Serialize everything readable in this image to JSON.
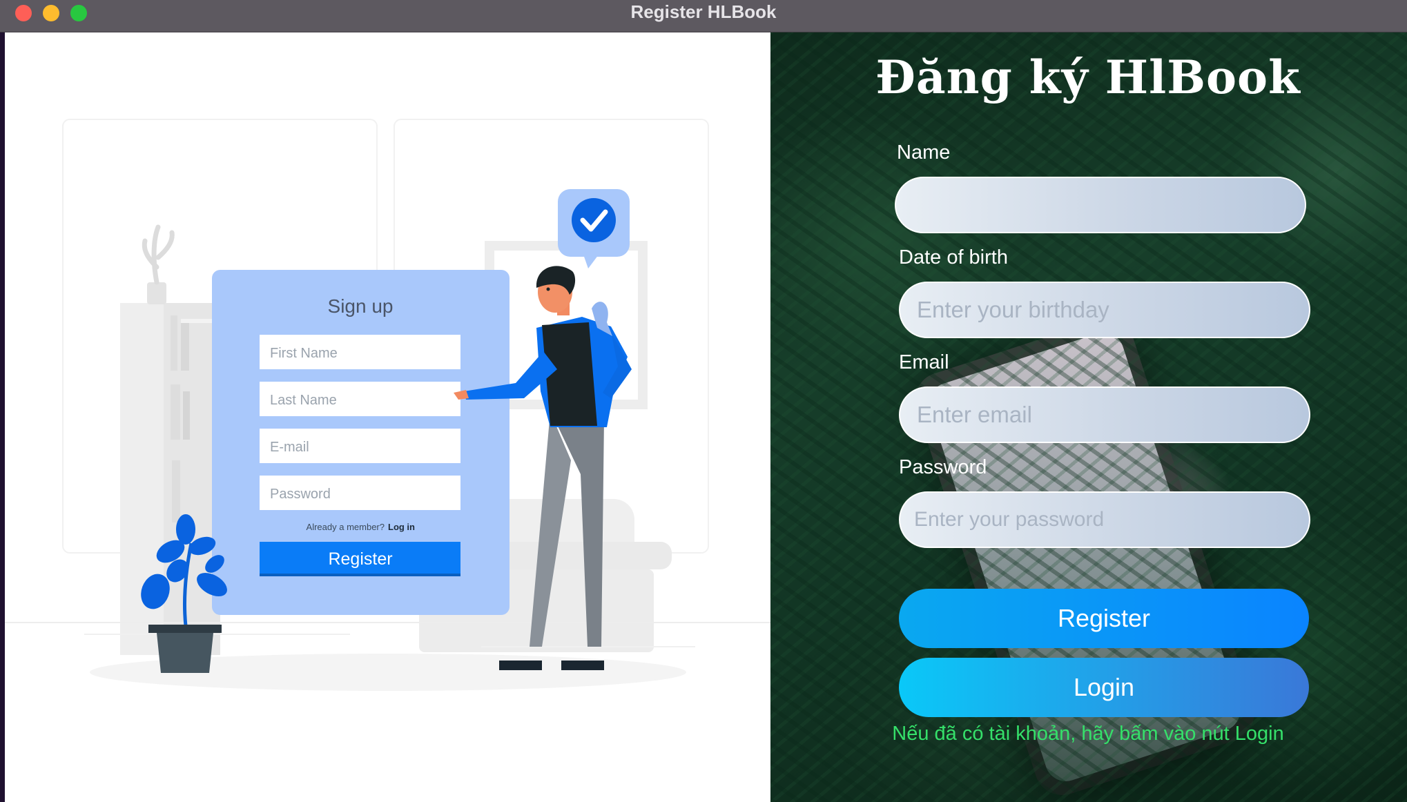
{
  "window": {
    "title": "Register HLBook"
  },
  "illustration": {
    "card_title": "Sign up",
    "fields": [
      "First Name",
      "Last Name",
      "E-mail",
      "Password"
    ],
    "member_text": "Already a member?",
    "login_link": "Log in",
    "register_button": "Register"
  },
  "form": {
    "title": "Đăng ký HlBook",
    "name_label": "Name",
    "name_placeholder": "",
    "birth_label": "Date  of birth",
    "birth_placeholder": "Enter your birthday",
    "email_label": "Email",
    "email_placeholder": "Enter email",
    "password_label": "Password",
    "password_placeholder": "Enter your password",
    "register_label": "Register",
    "login_label": "Login",
    "hint": "Nếu đã có tài khoản, hãy bấm vào nút Login"
  },
  "colors": {
    "accent": "#0a84ff",
    "illustration_blue": "#a9c8fb",
    "hint_green": "#35e06a"
  }
}
